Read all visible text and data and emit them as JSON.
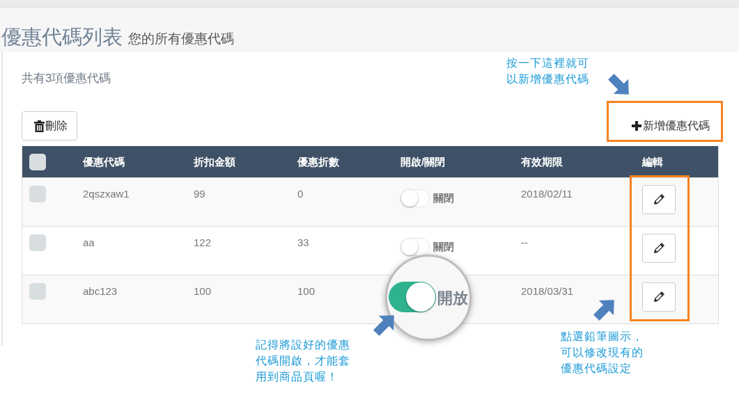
{
  "page_header": {
    "title": "優惠代碼列表",
    "subtitle": "您的所有優惠代碼"
  },
  "summary": "共有3項優惠代碼",
  "toolbar": {
    "delete_button": "刪除",
    "add_button": "新增優惠代碼"
  },
  "table": {
    "select_all_checked": false,
    "columns": [
      "優惠代碼",
      "折扣金額",
      "優惠折數",
      "開啟/關閉",
      "有效期限",
      "編輯"
    ],
    "rows": [
      {
        "checked": false,
        "code": "2qszxaw1",
        "amount": "99",
        "discount": "0",
        "enabled": false,
        "status_label": "關閉",
        "expiry": "2018/02/11",
        "magnified": false
      },
      {
        "checked": false,
        "code": "aa",
        "amount": "122",
        "discount": "33",
        "enabled": false,
        "status_label": "關閉",
        "expiry": "--",
        "magnified": false
      },
      {
        "checked": false,
        "code": "abc123",
        "amount": "100",
        "discount": "100",
        "enabled": true,
        "status_label": "開放",
        "expiry": "2018/03/31",
        "magnified": true
      }
    ]
  },
  "annotations": [
    {
      "text": "按一下這裡就可以新增優惠代碼"
    },
    {
      "text": "記得將設好的優惠代碼開啟，才能套用到商品頁喔！"
    },
    {
      "text": "點選鉛筆圖示，可以修改現有的優惠代碼設定"
    }
  ]
}
